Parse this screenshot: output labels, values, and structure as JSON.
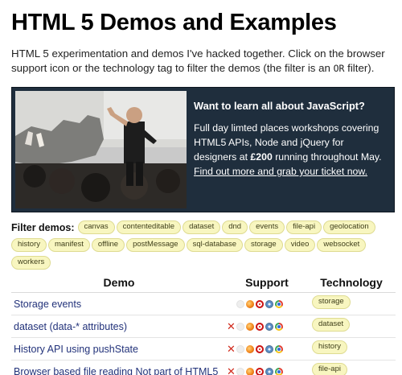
{
  "page": {
    "title": "HTML 5 Demos and Examples",
    "intro_before": "HTML 5 experimentation and demos I've hacked together. Click on the browser support icon or the technology tag to filter the demos (the filter is an ",
    "intro_code": "OR",
    "intro_after": " filter)."
  },
  "promo": {
    "heading": "Want to learn all about JavaScript?",
    "body_before": "Full day limted places workshops covering HTML5 APIs, Node and jQuery for designers at ",
    "price": "£200",
    "body_after": " running throughout May. ",
    "link": "Find out more and grab your ticket now."
  },
  "filter": {
    "label": "Filter demos:",
    "tags": [
      "canvas",
      "contenteditable",
      "dataset",
      "dnd",
      "events",
      "file-api",
      "geolocation",
      "history",
      "manifest",
      "offline",
      "postMessage",
      "sql-database",
      "storage",
      "video",
      "websocket",
      "workers"
    ]
  },
  "table": {
    "headers": {
      "demo": "Demo",
      "support": "Support",
      "technology": "Technology"
    },
    "rows": [
      {
        "demo": "Storage events",
        "tag": "storage",
        "support": [
          "none",
          "ie",
          "firefox",
          "opera",
          "safari",
          "chrome"
        ]
      },
      {
        "demo": "dataset (data-* attributes)",
        "tag": "dataset",
        "support": [
          "no",
          "ie",
          "firefox",
          "opera",
          "safari",
          "chrome"
        ]
      },
      {
        "demo": "History API using pushState",
        "tag": "history",
        "support": [
          "no",
          "ie",
          "firefox",
          "opera",
          "safari",
          "chrome"
        ]
      },
      {
        "demo": "Browser based file reading Not part of HTML5",
        "tag": "file-api",
        "support": [
          "no",
          "ie",
          "firefox",
          "opera",
          "safari",
          "chrome"
        ]
      }
    ]
  },
  "colors": {
    "promo_bg": "#1f2e3d",
    "tag_bg": "#f8f6c0",
    "tag_border": "#dedb91",
    "link": "#22327a",
    "no_support": "#d02b1d"
  }
}
